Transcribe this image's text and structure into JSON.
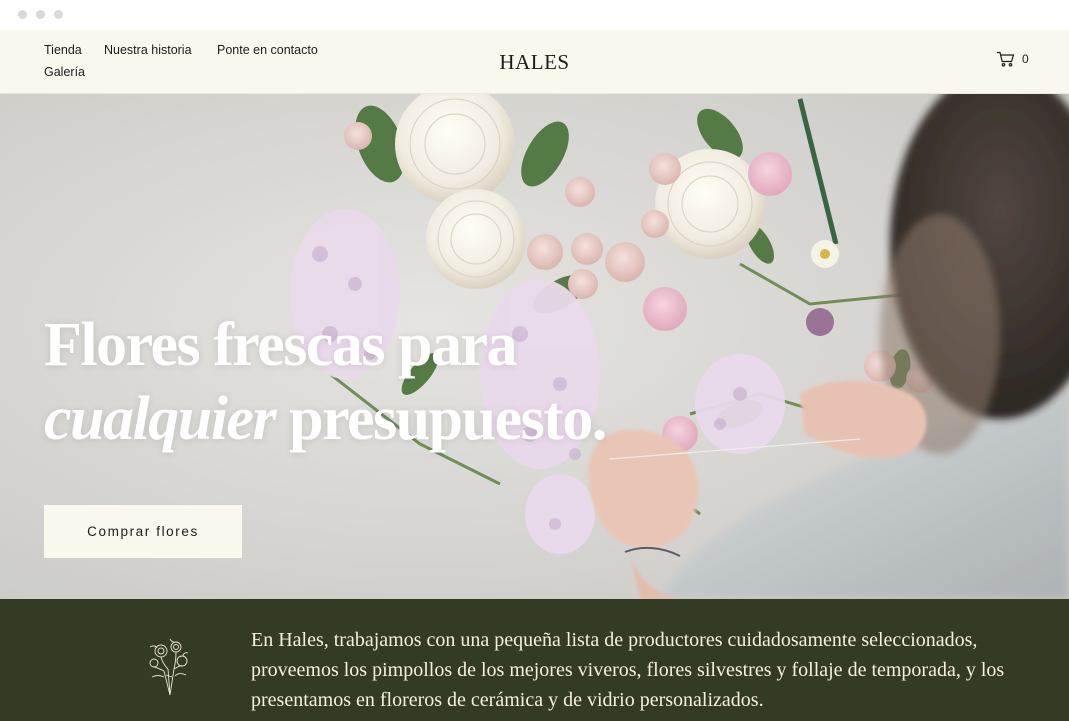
{
  "header": {
    "nav": [
      "Tienda",
      "Nuestra historia",
      "Ponte en contacto",
      "Galería"
    ],
    "logo": "HALES",
    "cart_icon": "cart-icon",
    "cart_count": "0"
  },
  "hero": {
    "title_line1": "Flores frescas para",
    "title_line2_italic": "cualquier",
    "title_line2_rest": " presupuesto.",
    "cta_label": "Comprar flores",
    "image": "florist-arranging-flowers-photo"
  },
  "about": {
    "icon": "flower-bouquet-sketch-icon",
    "text": "En Hales, trabajamos con una pequeña lista de productores cuidadosamente seleccionados, proveemos los pimpollos de los mejores viveros, flores silvestres y follaje de temporada, y los presentamos en floreros de cerámica y de vidrio personalizados."
  },
  "colors": {
    "header_bg": "#faf7ef",
    "section_bg": "#343b24",
    "section_text": "#f4efe2"
  }
}
